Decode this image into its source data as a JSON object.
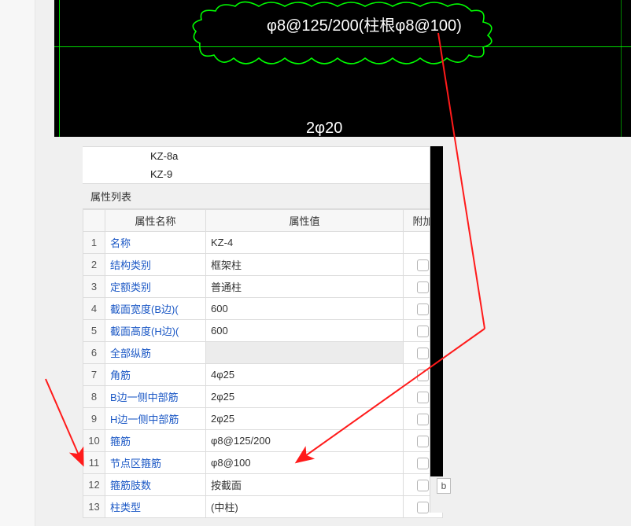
{
  "cad": {
    "annot_text": "φ8@125/200(柱根φ8@100)",
    "bottom_label": "2φ20"
  },
  "panel": {
    "top_items": [
      "KZ-8a",
      "KZ-9"
    ],
    "section_title": "属性列表",
    "columns": {
      "blank": "",
      "name": "属性名称",
      "value": "属性值",
      "extra": "附加"
    },
    "rows": [
      {
        "idx": "1",
        "name": "名称",
        "value": "KZ-4",
        "ck": null
      },
      {
        "idx": "2",
        "name": "结构类别",
        "value": "框架柱",
        "ck": false
      },
      {
        "idx": "3",
        "name": "定额类别",
        "value": "普通柱",
        "ck": false
      },
      {
        "idx": "4",
        "name": "截面宽度(B边)(",
        "value": "600",
        "ck": false
      },
      {
        "idx": "5",
        "name": "截面高度(H边)(",
        "value": "600",
        "ck": false
      },
      {
        "idx": "6",
        "name": "全部纵筋",
        "value": "",
        "ck": false,
        "disabled": true
      },
      {
        "idx": "7",
        "name": "角筋",
        "value": "4φ25",
        "ck": false
      },
      {
        "idx": "8",
        "name": "B边一侧中部筋",
        "value": "2φ25",
        "ck": false
      },
      {
        "idx": "9",
        "name": "H边一侧中部筋",
        "value": "2φ25",
        "ck": false
      },
      {
        "idx": "10",
        "name": "箍筋",
        "value": "φ8@125/200",
        "ck": false
      },
      {
        "idx": "11",
        "name": "节点区箍筋",
        "value": "φ8@100",
        "ck": false
      },
      {
        "idx": "12",
        "name": "箍筋肢数",
        "value": "按截面",
        "ck": false
      },
      {
        "idx": "13",
        "name": "柱类型",
        "value": "(中柱)",
        "ck": false
      }
    ]
  },
  "small_box_label": "b"
}
